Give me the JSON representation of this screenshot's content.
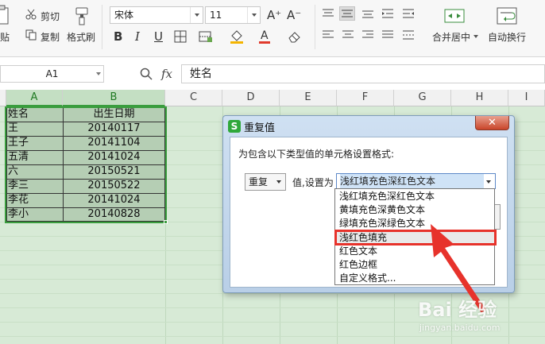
{
  "ribbon": {
    "paste_label": "贴",
    "cut_label": "剪切",
    "copy_label": "复制",
    "format_painter_label": "格式刷",
    "font_name": "宋体",
    "font_size": "11",
    "bold": "B",
    "italic": "I",
    "underline": "U",
    "font_color_letter": "A",
    "grow_font": "A⁺",
    "shrink_font": "A⁻",
    "merge_center_label": "合并居中",
    "wrap_text_label": "自动换行"
  },
  "formula_bar": {
    "name_box": "A1",
    "fx_label": "fx",
    "content": "姓名"
  },
  "grid": {
    "columns": [
      "A",
      "B",
      "C",
      "D",
      "E",
      "F",
      "G",
      "H",
      "I"
    ],
    "rows": [
      {
        "name": "姓名",
        "date": "出生日期"
      },
      {
        "name": "王",
        "date": "20140117"
      },
      {
        "name": "王子",
        "date": "20141104"
      },
      {
        "name": "五清",
        "date": "20141024"
      },
      {
        "name": "六",
        "date": "20150521"
      },
      {
        "name": "李三",
        "date": "20150522"
      },
      {
        "name": "李花",
        "date": "20141024"
      },
      {
        "name": "李小",
        "date": "20140828"
      }
    ]
  },
  "dialog": {
    "title": "重复值",
    "close": "✕",
    "rule_label": "为包含以下类型值的单元格设置格式:",
    "duplicate_select": "重复",
    "set_as_label": "值,设置为",
    "format_selected": "浅红填充色深红色文本",
    "options": [
      "浅红填充色深红色文本",
      "黄填充色深黄色文本",
      "绿填充色深绿色文本",
      "浅红色填充",
      "红色文本",
      "红色边框",
      "自定义格式..."
    ],
    "highlighted_option_index": 3
  },
  "watermark": {
    "main": "Bai  经验",
    "sub": "jingyan.baidu.com"
  },
  "colors": {
    "sheet_bg": "#d7ead6",
    "selection_green": "#3a9d3e",
    "highlight_red": "#e7322b",
    "dialog_frame": "#b9cfe7"
  }
}
